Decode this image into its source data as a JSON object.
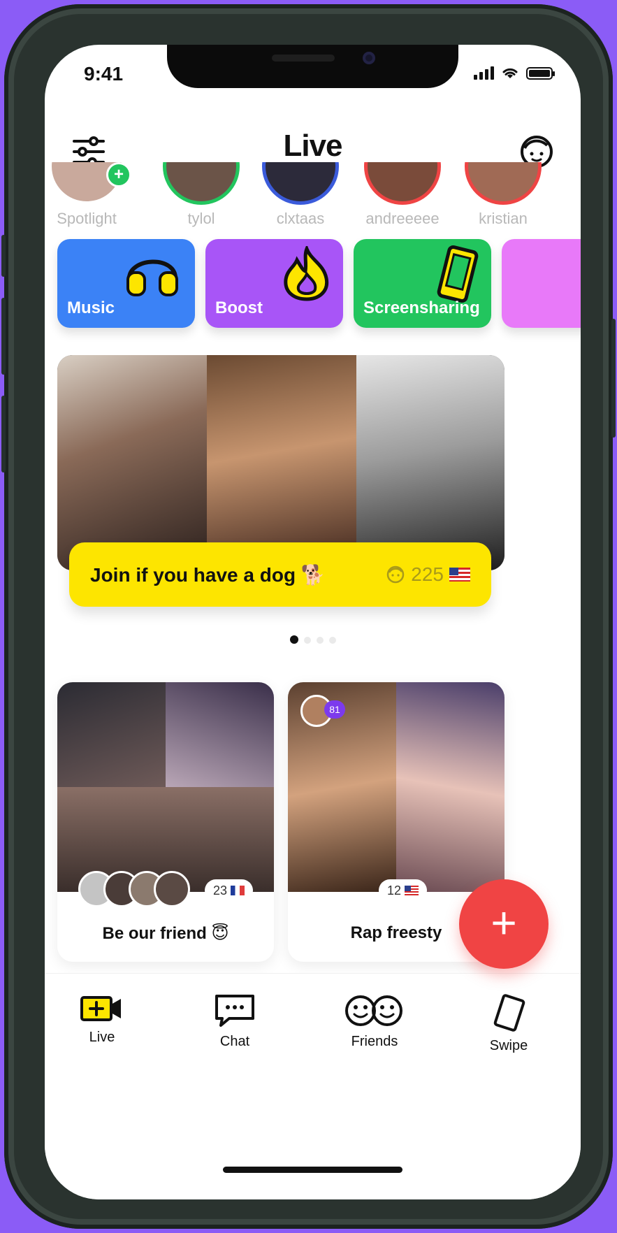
{
  "status_bar": {
    "time": "9:41"
  },
  "header": {
    "title": "Live"
  },
  "stories": [
    {
      "name": "Spotlight",
      "ring": "#ffffff",
      "avatar_color": "#c9a99c",
      "badge": "+"
    },
    {
      "name": "tylol",
      "ring": "#22c55e",
      "avatar_color": "#6b5448"
    },
    {
      "name": "clxtaas",
      "ring": "#3b5bdb",
      "avatar_color": "#2c2a3a"
    },
    {
      "name": "andreeeee",
      "ring": "#ef4444",
      "avatar_color": "#7a4b3a"
    },
    {
      "name": "kristian",
      "ring": "#ef4444",
      "avatar_color": "#a06a55"
    }
  ],
  "features": [
    {
      "label": "Music",
      "color": "#3b82f6",
      "icon": "headphones-icon"
    },
    {
      "label": "Boost",
      "color": "#a855f7",
      "icon": "fire-icon"
    },
    {
      "label": "Screensharing",
      "color": "#22c55e",
      "icon": "phone-icon"
    },
    {
      "label": "",
      "color": "#e879f9",
      "icon": ""
    }
  ],
  "hero": {
    "caption": "Join if you have a dog 🐕",
    "count": "225",
    "flag": "us-flag"
  },
  "carousel": {
    "pages": 4,
    "active": 1
  },
  "rooms": [
    {
      "title": "Be our friend 😇",
      "count": "23",
      "flag": "fr-flag"
    },
    {
      "title": "Rap freesty",
      "count": "12",
      "flag": "us-flag",
      "host_badge": "81"
    }
  ],
  "fab": {
    "label": "+"
  },
  "tabs": [
    {
      "label": "Live",
      "icon": "live-video-icon",
      "active": true
    },
    {
      "label": "Chat",
      "icon": "chat-bubble-icon"
    },
    {
      "label": "Friends",
      "icon": "friends-faces-icon"
    },
    {
      "label": "Swipe",
      "icon": "swipe-card-icon"
    }
  ],
  "colors": {
    "background": "#8b5cf6",
    "caption_yellow": "#fde500",
    "fab_red": "#f04444"
  }
}
